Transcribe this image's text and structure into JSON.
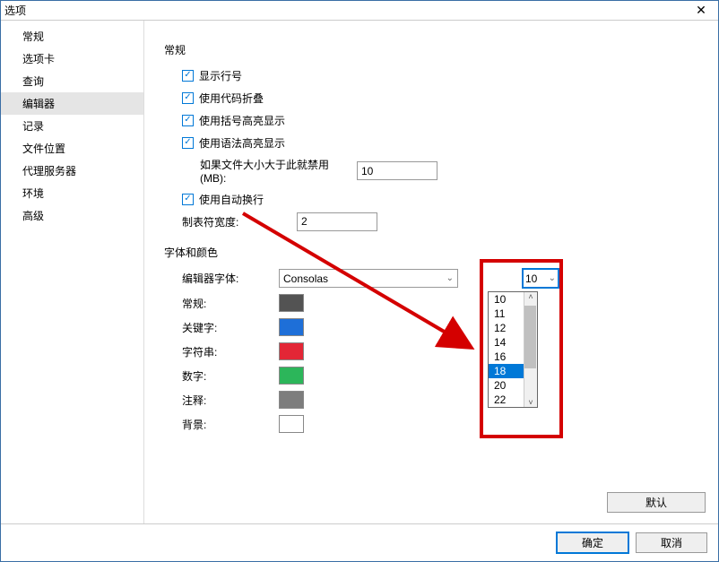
{
  "window": {
    "title": "选项"
  },
  "sidebar": {
    "items": [
      {
        "label": "常规"
      },
      {
        "label": "选项卡"
      },
      {
        "label": "查询"
      },
      {
        "label": "编辑器",
        "selected": true
      },
      {
        "label": "记录"
      },
      {
        "label": "文件位置"
      },
      {
        "label": "代理服务器"
      },
      {
        "label": "环境"
      },
      {
        "label": "高级"
      }
    ]
  },
  "sections": {
    "general": {
      "title": "常规",
      "opts": {
        "line_numbers": "显示行号",
        "code_folding": "使用代码折叠",
        "bracket_highlight": "使用括号高亮显示",
        "syntax_highlight": "使用语法高亮显示",
        "word_wrap": "使用自动换行"
      },
      "disable_mb_label": "如果文件大小大于此就禁用 (MB):",
      "disable_mb_value": "10",
      "tab_width_label": "制表符宽度:",
      "tab_width_value": "2"
    },
    "font": {
      "title": "字体和颜色",
      "editor_font_label": "编辑器字体:",
      "editor_font_value": "Consolas",
      "size_value": "10",
      "size_options": [
        "10",
        "11",
        "12",
        "14",
        "16",
        "18",
        "20",
        "22"
      ],
      "size_highlight": "18",
      "rows": {
        "normal": {
          "label": "常规:",
          "color": "#535353"
        },
        "keyword": {
          "label": "关键字:",
          "color": "#1e6fd8"
        },
        "string": {
          "label": "字符串:",
          "color": "#e32636"
        },
        "number": {
          "label": "数字:",
          "color": "#2cb65a"
        },
        "comment": {
          "label": "注释:",
          "color": "#7d7d7d"
        },
        "background": {
          "label": "背景:",
          "color": "#ffffff"
        }
      }
    }
  },
  "buttons": {
    "default": "默认",
    "ok": "确定",
    "cancel": "取消"
  }
}
